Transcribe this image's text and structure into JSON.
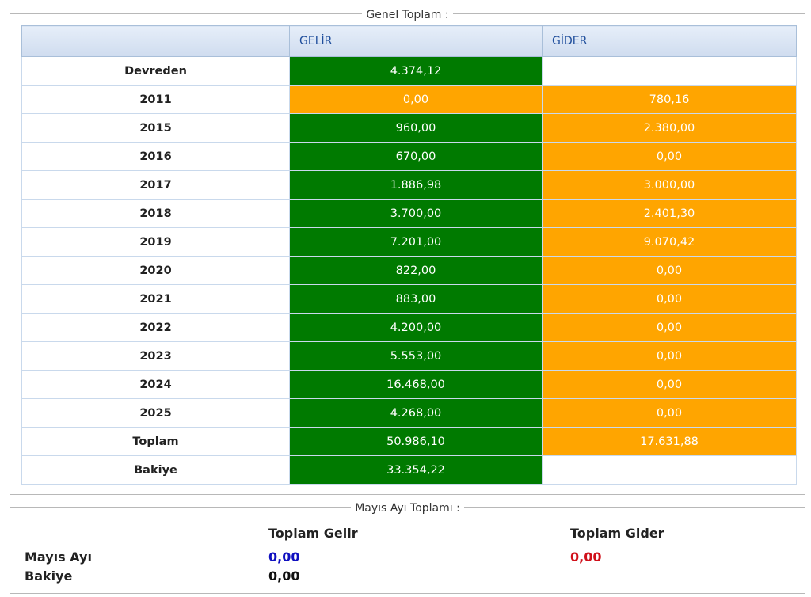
{
  "genel": {
    "legend": "Genel Toplam :",
    "headers": {
      "label": "",
      "gelir": "GELİR",
      "gider": "GİDER"
    },
    "rows": [
      {
        "label": "Devreden",
        "gelir": "4.374,12",
        "gider": "",
        "gelir_color": "green",
        "gider_color": "empty"
      },
      {
        "label": "2011",
        "gelir": "0,00",
        "gider": "780,16",
        "gelir_color": "orange",
        "gider_color": "orange"
      },
      {
        "label": "2015",
        "gelir": "960,00",
        "gider": "2.380,00",
        "gelir_color": "green",
        "gider_color": "orange"
      },
      {
        "label": "2016",
        "gelir": "670,00",
        "gider": "0,00",
        "gelir_color": "green",
        "gider_color": "orange"
      },
      {
        "label": "2017",
        "gelir": "1.886,98",
        "gider": "3.000,00",
        "gelir_color": "green",
        "gider_color": "orange"
      },
      {
        "label": "2018",
        "gelir": "3.700,00",
        "gider": "2.401,30",
        "gelir_color": "green",
        "gider_color": "orange"
      },
      {
        "label": "2019",
        "gelir": "7.201,00",
        "gider": "9.070,42",
        "gelir_color": "green",
        "gider_color": "orange"
      },
      {
        "label": "2020",
        "gelir": "822,00",
        "gider": "0,00",
        "gelir_color": "green",
        "gider_color": "orange"
      },
      {
        "label": "2021",
        "gelir": "883,00",
        "gider": "0,00",
        "gelir_color": "green",
        "gider_color": "orange"
      },
      {
        "label": "2022",
        "gelir": "4.200,00",
        "gider": "0,00",
        "gelir_color": "green",
        "gider_color": "orange"
      },
      {
        "label": "2023",
        "gelir": "5.553,00",
        "gider": "0,00",
        "gelir_color": "green",
        "gider_color": "orange"
      },
      {
        "label": "2024",
        "gelir": "16.468,00",
        "gider": "0,00",
        "gelir_color": "green",
        "gider_color": "orange"
      },
      {
        "label": "2025",
        "gelir": "4.268,00",
        "gider": "0,00",
        "gelir_color": "green",
        "gider_color": "orange"
      },
      {
        "label": "Toplam",
        "gelir": "50.986,10",
        "gider": "17.631,88",
        "gelir_color": "green",
        "gider_color": "orange"
      },
      {
        "label": "Bakiye",
        "gelir": "33.354,22",
        "gider": "",
        "gelir_color": "green",
        "gider_color": "empty"
      }
    ]
  },
  "mayis": {
    "legend": "Mayıs Ayı Toplamı :",
    "toplam_gelir_label": "Toplam Gelir",
    "toplam_gider_label": "Toplam Gider",
    "ay_label": "Mayıs Ayı",
    "bakiye_label": "Bakiye",
    "gelir_value": "0,00",
    "gider_value": "0,00",
    "bakiye_value": "0,00"
  },
  "colors": {
    "green": "#007a00",
    "orange": "#ffa500",
    "header_text": "#1f4e9c",
    "gelir_value": "#1010c0",
    "gider_value": "#d0101a"
  }
}
